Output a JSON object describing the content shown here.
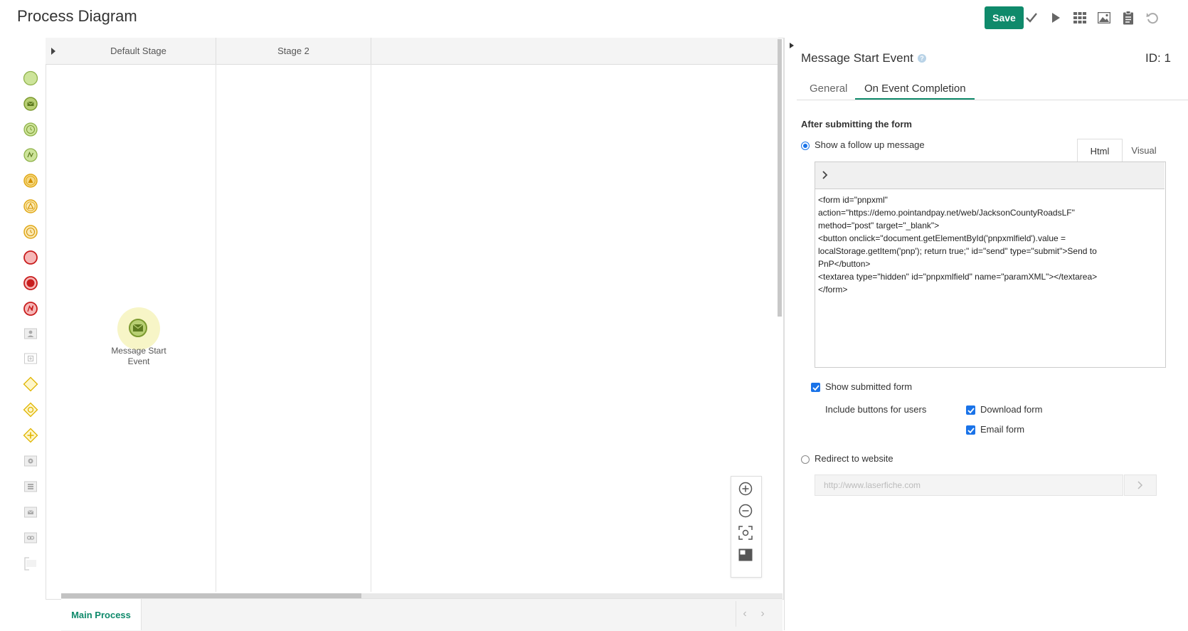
{
  "header": {
    "title": "Process Diagram",
    "save_label": "Save"
  },
  "toolbar_icons": [
    "check-icon",
    "play-icon",
    "grid-icon",
    "image-icon",
    "clipboard-icon",
    "undo-icon"
  ],
  "palette": [
    "start-event",
    "message-start-event",
    "timer-start-event",
    "signal-start-event",
    "escalation-intermediate-event",
    "escalation-boundary-event",
    "timer-intermediate-event",
    "end-event",
    "terminate-end-event",
    "error-end-event",
    "user-task",
    "subprocess",
    "exclusive-gateway",
    "inclusive-gateway",
    "parallel-gateway",
    "service-task",
    "script-task",
    "send-message-task",
    "link-task",
    "annotation"
  ],
  "canvas": {
    "stages": [
      "Default Stage",
      "Stage 2"
    ],
    "node_label_line1": "Message Start",
    "node_label_line2": "Event",
    "tab_main": "Main Process"
  },
  "panel": {
    "title": "Message Start Event",
    "id_label": "ID: 1",
    "tabs": [
      "General",
      "On Event Completion"
    ],
    "active_tab": "On Event Completion",
    "section_title": "After submitting the form",
    "option_followup": "Show a follow up message",
    "editor_tabs": [
      "Html",
      "Visual"
    ],
    "editor_content": "<form id=\"pnpxml\"\naction=\"https://demo.pointandpay.net/web/JacksonCountyRoadsLF\"\nmethod=\"post\" target=\"_blank\">\n<button onclick=\"document.getElementById('pnpxmlfield').value =\nlocalStorage.getItem('pnp'); return true;\" id=\"send\" type=\"submit\">Send to\nPnP</button>\n<textarea type=\"hidden\" id=\"pnpxmlfield\" name=\"paramXML\"></textarea>\n</form>",
    "show_submitted_form": "Show submitted form",
    "include_buttons": "Include buttons for users",
    "download_form": "Download form",
    "email_form": "Email form",
    "redirect": "Redirect to website",
    "redirect_placeholder": "http://www.laserfiche.com"
  },
  "colors": {
    "accent": "#0f8a6b",
    "checkbox": "#1a73e8"
  }
}
